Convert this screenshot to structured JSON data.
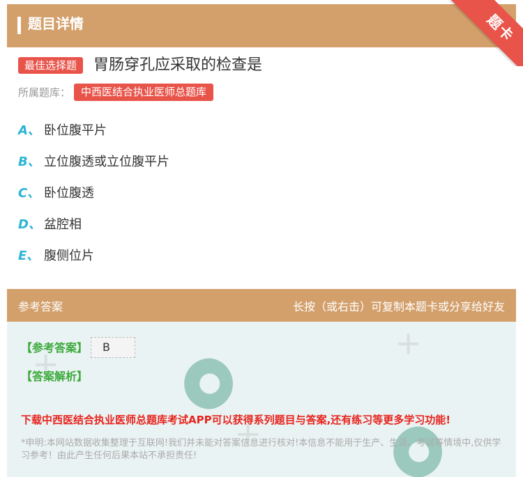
{
  "header": {
    "title": "题目详情"
  },
  "ribbon": {
    "label": "题卡"
  },
  "question": {
    "type_badge": "最佳选择题",
    "text": "胃肠穿孔应采取的检查是",
    "library_label": "所属题库：",
    "library_name": "中西医结合执业医师总题库"
  },
  "options": [
    {
      "letter": "A、",
      "text": "卧位腹平片"
    },
    {
      "letter": "B、",
      "text": "立位腹透或立位腹平片"
    },
    {
      "letter": "C、",
      "text": "卧位腹透"
    },
    {
      "letter": "D、",
      "text": "盆腔相"
    },
    {
      "letter": "E、",
      "text": "腹侧位片"
    }
  ],
  "answer_section": {
    "title": "参考答案",
    "hint": "长按（或右击）可复制本题卡或分享给好友",
    "answer_label": "【参考答案】",
    "answer_value": "B",
    "analysis_label": "【答案解析】",
    "promo": "下载中西医结合执业医师总题库考试APP可以获得系列题目与答案,还有练习等更多学习功能!",
    "disclaimer": "*申明:本网站数据收集整理于互联网!我们并未能对答案信息进行核对!本信息不能用于生产、生活、考试等情境中,仅供学习参考！由此产生任何后果本站不承担责任!"
  },
  "colors": {
    "header_bg": "#d3a06c",
    "accent_red": "#e8544a",
    "option_letter": "#2ab5d4",
    "answer_green": "#3caa3c"
  }
}
